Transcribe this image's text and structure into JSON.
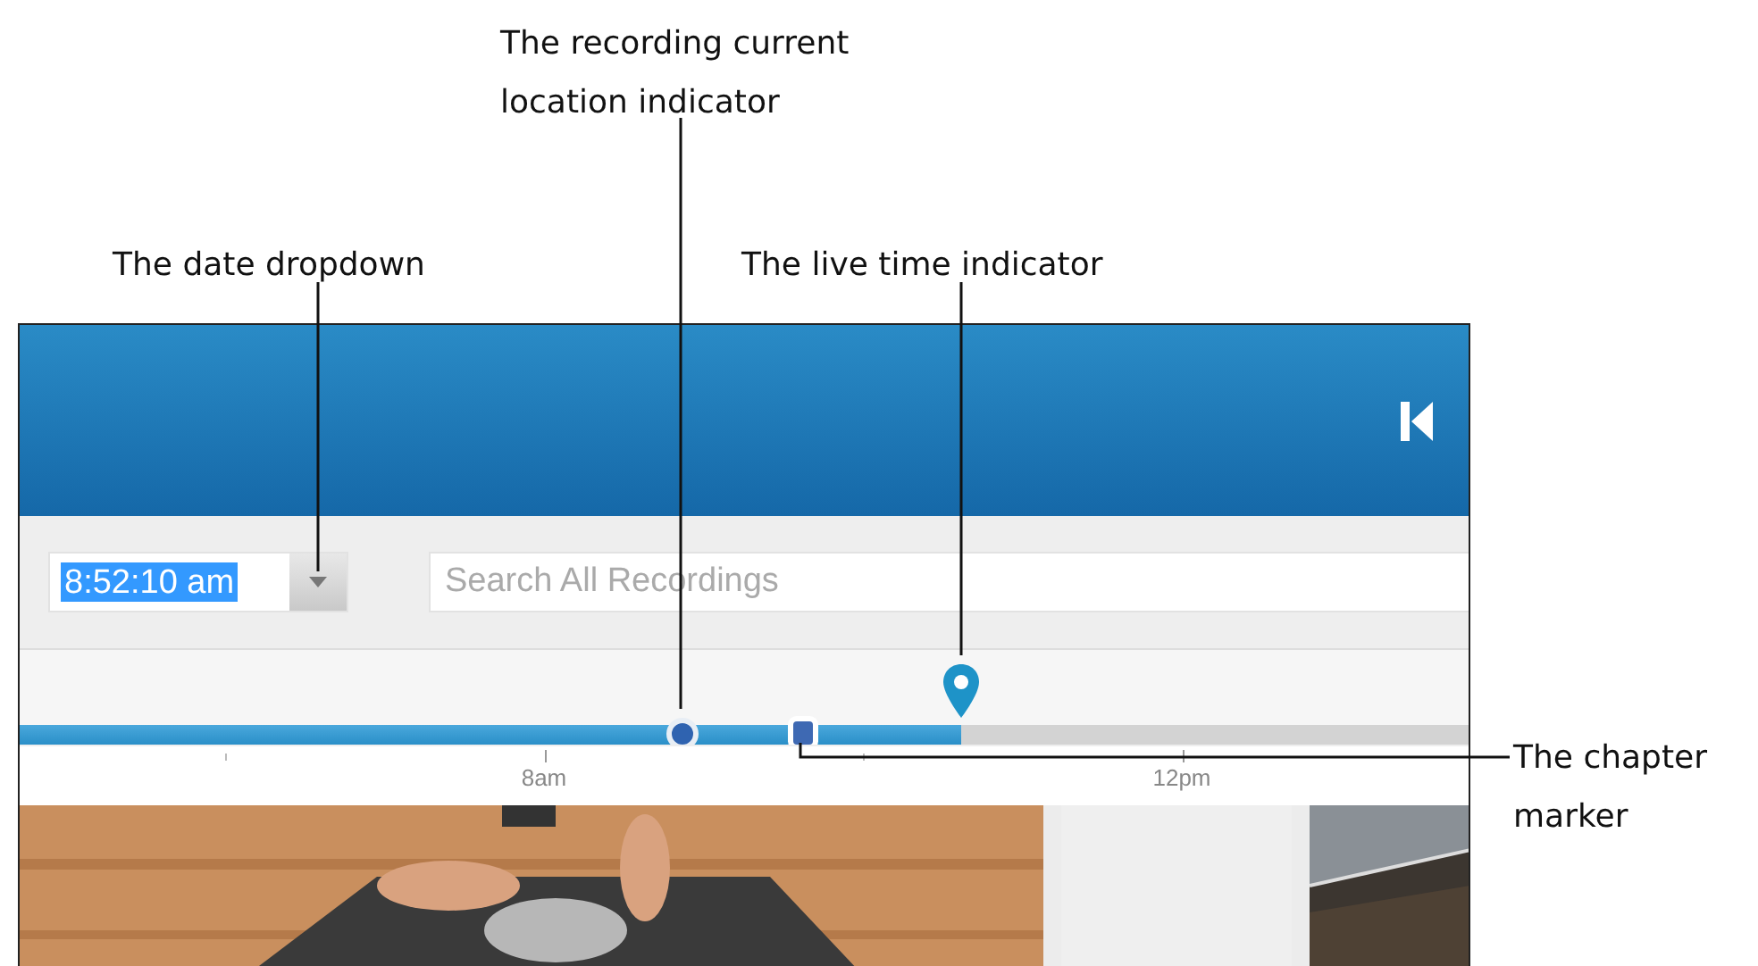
{
  "callouts": [
    {
      "text": "The recording current location indicator"
    },
    {
      "text": "The date dropdown"
    },
    {
      "text": "The live time indicator"
    },
    {
      "text": "The chapter marker"
    }
  ],
  "toolbar": {
    "date_field": {
      "value": "8:52:10 am",
      "selected": true
    },
    "search": {
      "placeholder": "Search All Recordings"
    }
  },
  "timeline": {
    "level": 0.65,
    "playhead": {
      "level": 0.457
    },
    "chapters": [
      {
        "level": 0.54
      }
    ],
    "ticks": [
      {
        "kind": "minor"
      },
      {
        "kind": "major",
        "label": "8am"
      },
      {
        "kind": "minor"
      },
      {
        "kind": "major",
        "label": "12pm"
      }
    ]
  },
  "panels": [
    {
      "kind": "picture"
    },
    {
      "kind": "empty"
    },
    {
      "kind": "picture"
    }
  ]
}
